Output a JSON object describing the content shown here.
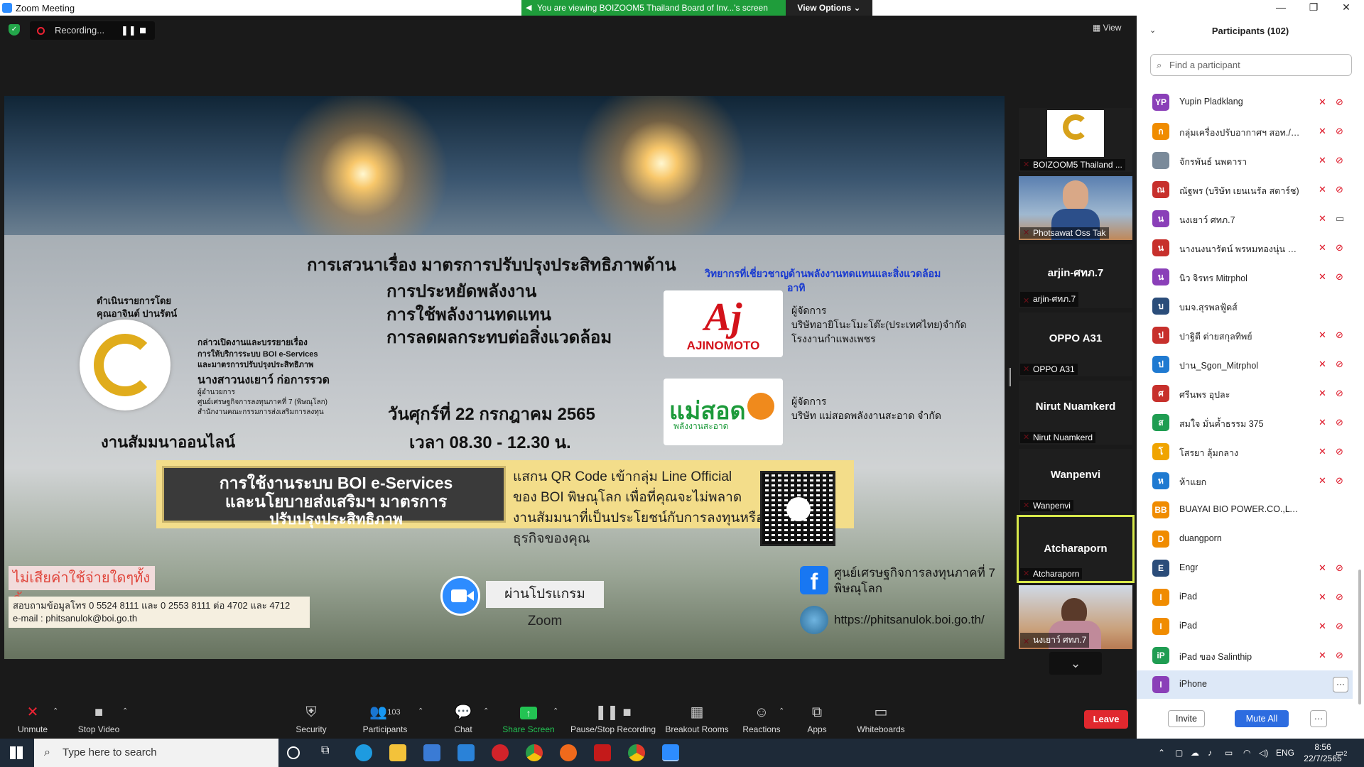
{
  "window": {
    "title": "Zoom Meeting"
  },
  "banner": {
    "text": "You are viewing BOIZOOM5 Thailand Board of Inv...'s screen",
    "view_options": "View Options ⌄"
  },
  "recording": {
    "label": "Recording..."
  },
  "view_button": "View",
  "slide": {
    "title_line1": "การเสวนาเรื่อง มาตรการปรับปรุงประสิทธิภาพด้าน",
    "title_line2": "การประหยัดพลังงาน",
    "title_line3": "การใช้พลังงานทดแทน",
    "title_line4": "การลดผลกระทบต่อสิ่งแวดล้อม",
    "organizer1": "ดำเนินรายการโดย",
    "organizer2": "คุณอาจินต์ ปานรัตน์",
    "opener1": "กล่าวเปิดงานและบรรยายเรื่อง",
    "opener2": "การให้บริการระบบ BOI e-Services",
    "opener3": "และมาตรการปรับปรุงประสิทธิภาพ",
    "opener_name": "นางสาวนงเยาว์ ก่อการรวด",
    "opener_role1": "ผู้อำนวยการ",
    "opener_role2": "ศูนย์เศรษฐกิจการลงทุนภาคที่ 7 (พิษณุโลก)",
    "opener_role3": "สำนักงานคณะกรรมการส่งเสริมการลงทุน",
    "online": "งานสัมมนาออนไลน์",
    "experts1": "วิทยากรที่เชี่ยวชาญด้านพลังงานทดแทนและสิ่งแวดล้อม",
    "experts2": "อาทิ",
    "aji_logo": "Aj",
    "aji_name": "AJINOMOTO",
    "aji_role": "ผู้จัดการ",
    "aji_company": "บริษัทอายิโนะโมะโต๊ะ(ประเทศไทย)จำกัด",
    "aji_plant": "โรงงานกำแพงเพชร",
    "maesot_logo": "แม่สอด",
    "maesot_sub": "พลังงานสะอาด",
    "maesot_role": "ผู้จัดการ",
    "maesot_company": "บริษัท แม่สอดพลังงานสะอาด จำกัด",
    "date": "วันศุกร์ที่ 22 กรกฎาคม 2565",
    "time": "เวลา 08.30 - 12.30 น.",
    "box_line1": "การใช้งานระบบ BOI e-Services",
    "box_line2": "และนโยบายส่งเสริมฯ มาตรการ",
    "box_line3": "ปรับปรุงประสิทธิภาพ",
    "qr_line1": "แสกน QR Code เข้ากลุ่ม Line Official",
    "qr_line2": "ของ BOI พิษณุโลก เพื่อที่คุณจะไม่พลาด",
    "qr_line3": "งานสัมมนาที่เป็นประโยชน์กับการลงทุนหรือ",
    "qr_line4": "ธุรกิจของคุณ",
    "no_fee": "ไม่เสียค่าใช้จ่ายใดๆทั้งสิ้น",
    "contact1": "สอบถามข้อมูลโทร 0 5524 8111 และ 0 2553 8111 ต่อ 4702 และ 4712",
    "contact2": "e-mail : phitsanulok@boi.go.th",
    "via_zoom": "ผ่านโปรแกรม Zoom",
    "fb_text": "ศูนย์เศรษฐกิจการลงทุนภาคที่ 7",
    "fb_text2": "พิษณุโลก",
    "website": "https://phitsanulok.boi.go.th/"
  },
  "thumbnails": [
    {
      "label": "BOIZOOM5 Thailand ..."
    },
    {
      "label": "Photsawat Oss Tak"
    },
    {
      "name": "arjin-ศทภ.7",
      "label": "arjin-ศทภ.7"
    },
    {
      "name": "OPPO A31",
      "label": "OPPO A31"
    },
    {
      "name": "Nirut Nuamkerd",
      "label": "Nirut Nuamkerd"
    },
    {
      "name": "Wanpenvi",
      "label": "Wanpenvi"
    },
    {
      "name": "Atcharaporn",
      "label": "Atcharaporn"
    },
    {
      "label": "นงเยาว์ ศทภ.7"
    }
  ],
  "toolbar": {
    "unmute": "Unmute",
    "stop_video": "Stop Video",
    "security": "Security",
    "participants": "Participants",
    "participants_count": "103",
    "chat": "Chat",
    "share_screen": "Share Screen",
    "pause_recording": "Pause/Stop Recording",
    "breakout": "Breakout Rooms",
    "reactions": "Reactions",
    "apps": "Apps",
    "whiteboards": "Whiteboards",
    "leave": "Leave"
  },
  "panel": {
    "title": "Participants (102)",
    "search_placeholder": "Find a participant",
    "invite": "Invite",
    "mute_all": "Mute All",
    "more": "···",
    "participants": [
      {
        "initials": "YP",
        "name": "Yupin Pladklang",
        "color": "#8a3fb8"
      },
      {
        "initials": "ก",
        "name": "กลุ่มเครื่องปรับอากาศฯ สอท./ภาวนา ...",
        "color": "#f08c00"
      },
      {
        "initials": "",
        "name": "จักรพันธ์ นพดารา",
        "color": "#7a8a9a"
      },
      {
        "initials": "ณ",
        "name": "ณัฐพร (บริษัท เยนเนรัล สตาร์ช)",
        "color": "#c7302c"
      },
      {
        "initials": "น",
        "name": "นงเยาว์ ศทภ.7",
        "color": "#8a3fb8"
      },
      {
        "initials": "น",
        "name": "นางนงนารัตน์ พรหมทองนุ่น ศูนย์ศร...",
        "color": "#c7302c"
      },
      {
        "initials": "น",
        "name": "นิว จิรทร Mitrphol",
        "color": "#8a3fb8"
      },
      {
        "initials": "บ",
        "name": "บมจ.สุรพลฟู้ดส์",
        "color": "#2b4d7a"
      },
      {
        "initials": "ป",
        "name": "ปาฐิตี ต่ายสกุลทิพย์",
        "color": "#c7302c"
      },
      {
        "initials": "ป",
        "name": "ปาน_Sgon_Mitrphol",
        "color": "#1f7ad1"
      },
      {
        "initials": "ศ",
        "name": "ศรีนพร อุปละ",
        "color": "#c7302c"
      },
      {
        "initials": "ส",
        "name": "สมใจ มั่นค้ำธรรม 375",
        "color": "#1f9d52"
      },
      {
        "initials": "โ",
        "name": "โสรยา ลุ้มกลาง",
        "color": "#f0a400"
      },
      {
        "initials": "ห",
        "name": "ห้าแยก",
        "color": "#1f7ad1"
      },
      {
        "initials": "BB",
        "name": "BUAYAI BIO POWER.CO.,LTD.",
        "color": "#f08c00"
      },
      {
        "initials": "D",
        "name": "duangporn",
        "color": "#f08c00"
      },
      {
        "initials": "E",
        "name": "Engr",
        "color": "#2b4d7a"
      },
      {
        "initials": "I",
        "name": "iPad",
        "color": "#f08c00"
      },
      {
        "initials": "I",
        "name": "iPad",
        "color": "#f08c00"
      },
      {
        "initials": "iP",
        "name": "iPad ของ Salinthip",
        "color": "#1f9d52"
      },
      {
        "initials": "I",
        "name": "iPhone",
        "color": "#8a3fb8"
      }
    ]
  },
  "taskbar": {
    "search_placeholder": "Type here to search",
    "lang": "ENG",
    "time": "8:56",
    "date": "22/7/2565",
    "notif": "2"
  }
}
